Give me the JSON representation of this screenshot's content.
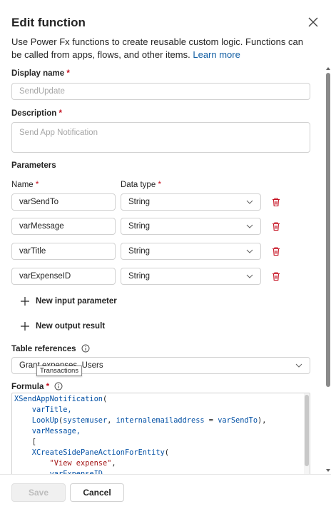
{
  "dialog": {
    "title": "Edit function",
    "description": "Use Power Fx functions to create reusable custom logic. Functions can be called from apps, flows, and other items.",
    "learn_more": "Learn more"
  },
  "display_name": {
    "label": "Display name",
    "required_mark": "*",
    "placeholder": "SendUpdate"
  },
  "description_field": {
    "label": "Description",
    "required_mark": "*",
    "placeholder": "Send App Notification"
  },
  "parameters": {
    "section_label": "Parameters",
    "name_header": "Name",
    "type_header": "Data type",
    "required_mark": "*",
    "rows": [
      {
        "name": "varSendTo",
        "type": "String"
      },
      {
        "name": "varMessage",
        "type": "String"
      },
      {
        "name": "varTitle",
        "type": "String"
      },
      {
        "name": "varExpenseID",
        "type": "String"
      }
    ],
    "add_input": "New input parameter",
    "add_output": "New output result"
  },
  "table_references": {
    "label": "Table references",
    "value": "Grant expenses, Users",
    "tooltip": "Transactions"
  },
  "formula": {
    "label": "Formula",
    "required_mark": "*",
    "lines": [
      {
        "parts": [
          {
            "t": "XSendAppNotification",
            "c": "fn"
          },
          {
            "t": "(",
            "c": "plain"
          }
        ]
      },
      {
        "parts": [
          {
            "t": "    varTitle,",
            "c": "id"
          }
        ]
      },
      {
        "parts": [
          {
            "t": "    LookUp",
            "c": "fn"
          },
          {
            "t": "(",
            "c": "plain"
          },
          {
            "t": "systemuser",
            "c": "id"
          },
          {
            "t": ", ",
            "c": "plain"
          },
          {
            "t": "internalemailaddress",
            "c": "id"
          },
          {
            "t": " = ",
            "c": "plain"
          },
          {
            "t": "varSendTo",
            "c": "id"
          },
          {
            "t": "),",
            "c": "plain"
          }
        ]
      },
      {
        "parts": [
          {
            "t": "    varMessage,",
            "c": "id"
          }
        ]
      },
      {
        "parts": [
          {
            "t": "    [",
            "c": "plain"
          }
        ]
      },
      {
        "parts": [
          {
            "t": "    XCreateSidePaneActionForEntity",
            "c": "fn"
          },
          {
            "t": "(",
            "c": "plain"
          }
        ]
      },
      {
        "parts": [
          {
            "t": "        \"View expense\"",
            "c": "str"
          },
          {
            "t": ",",
            "c": "plain"
          }
        ]
      },
      {
        "parts": [
          {
            "t": "        varExpenseID,",
            "c": "id"
          }
        ]
      }
    ]
  },
  "footer": {
    "save": "Save",
    "cancel": "Cancel"
  },
  "colors": {
    "accent": "#115ea3",
    "required": "#c50f1f",
    "delete": "#c50f1f"
  },
  "icons": [
    "close-icon",
    "trash-icon",
    "chevron-down-icon",
    "plus-icon",
    "info-icon"
  ]
}
